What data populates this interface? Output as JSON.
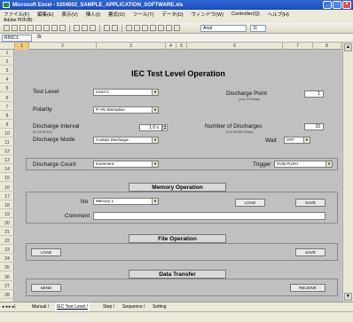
{
  "window": {
    "title": "Microsoft Excel - 0204002_SAMPLE_APPLICATION_SOFTWARE.xls"
  },
  "menu": {
    "items": [
      "ファイル(F)",
      "編集(E)",
      "表示(V)",
      "挿入(I)",
      "書式(O)",
      "ツール(T)",
      "データ(D)",
      "ウィンドウ(W)",
      "Controller(Q)",
      "ヘルプ(H)"
    ],
    "second_line": "Adobe PDF(B)"
  },
  "toolbar": {
    "font": "Arial",
    "size": "11"
  },
  "formula": {
    "namebox": "R50C1"
  },
  "columns": [
    "1",
    "2",
    "3",
    "4",
    "5",
    "6",
    "7",
    "8"
  ],
  "rows": [
    "1",
    "2",
    "3",
    "4",
    "5",
    "6",
    "7",
    "8",
    "9",
    "10",
    "11",
    "12",
    "13",
    "14",
    "15",
    "16",
    "17",
    "18",
    "19",
    "20",
    "21",
    "22",
    "23",
    "24",
    "25",
    "26",
    "27",
    "28"
  ],
  "form": {
    "title": "IEC Test Level Operation",
    "test_level": {
      "label": "Test Level",
      "value": "Level 2"
    },
    "polarity": {
      "label": "Polarity",
      "value": "P->N Alternation"
    },
    "discharge_interval": {
      "label": "Discharge Interval",
      "sub": "(0.1 to 99.9 s)",
      "value": "1.0 s"
    },
    "discharge_mode": {
      "label": "Discharge Mode",
      "value": "Contact Discharge"
    },
    "discharge_point": {
      "label": "Discharge Point",
      "sub": "(1 to 10 Points)",
      "value": "1"
    },
    "number_of_discharges": {
      "label": "Number of Discharges",
      "sub": "(1 to 99,999 Times)",
      "value": "10"
    },
    "wait": {
      "label": "Wait",
      "value": "OFF"
    },
    "discharge_count": {
      "label": "Discharge Count",
      "value": "Increment"
    },
    "trigger": {
      "label": "Trigger",
      "value": "GUN PUSH"
    }
  },
  "memory": {
    "header": "Memory Operation",
    "no_label": "No",
    "no_value": "Memory 1",
    "load": "LOAD",
    "save": "SAVE",
    "comment_label": "Comment"
  },
  "file": {
    "header": "File Operation",
    "load": "LOAD",
    "save": "SAVE"
  },
  "transfer": {
    "header": "Data Transfer",
    "send": "SEND",
    "receive": "RECEIVE"
  },
  "tabs": [
    "Manual",
    "IEC Test Level",
    "Step",
    "Sequence",
    "Setting"
  ],
  "tabnav": "◂ ◂ ▸ ▸|"
}
